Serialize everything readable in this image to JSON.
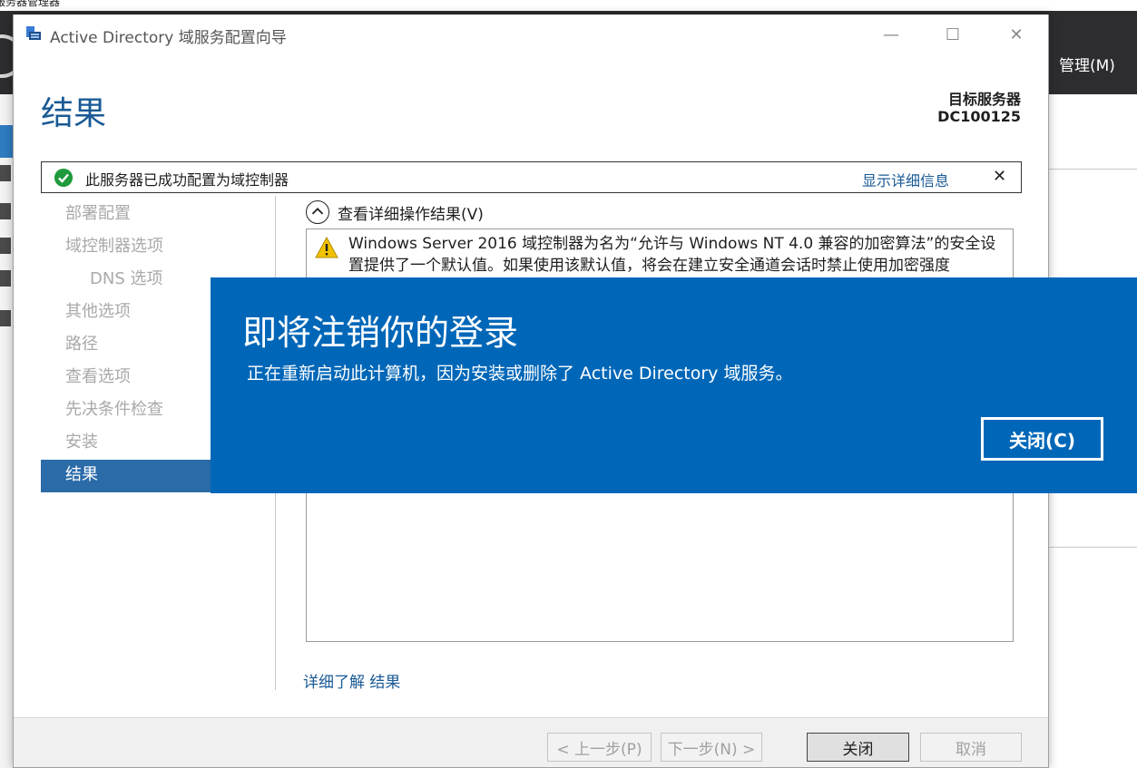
{
  "background": {
    "cut_title": "服务器管理器",
    "manage_menu": "管理(M)"
  },
  "window": {
    "title": "Active Directory 域服务配置向导",
    "minimize_glyph": "—",
    "maximize_glyph": "☐",
    "close_glyph": "✕"
  },
  "header": {
    "page_title": "结果",
    "target_label": "目标服务器",
    "target_name": "DC100125"
  },
  "notice": {
    "text": "此服务器已成功配置为域控制器",
    "details_link": "显示详细信息",
    "close_glyph": "✕"
  },
  "nav": {
    "items": [
      {
        "label": "部署配置",
        "sub": false,
        "active": false
      },
      {
        "label": "域控制器选项",
        "sub": false,
        "active": false
      },
      {
        "label": "DNS 选项",
        "sub": true,
        "active": false
      },
      {
        "label": "其他选项",
        "sub": false,
        "active": false
      },
      {
        "label": "路径",
        "sub": false,
        "active": false
      },
      {
        "label": "查看选项",
        "sub": false,
        "active": false
      },
      {
        "label": "先决条件检查",
        "sub": false,
        "active": false
      },
      {
        "label": "安装",
        "sub": false,
        "active": false
      },
      {
        "label": "结果",
        "sub": false,
        "active": true
      }
    ]
  },
  "results": {
    "expand_label": "查看详细操作结果(V)",
    "warning_text": "Windows Server 2016 域控制器为名为“允许与 Windows NT 4.0 兼容的加密算法”的安全设置提供了一个默认值。如果使用该默认值，将会在建立安全通道会话时禁止使用加密强度"
  },
  "learn_more_link": "详细了解 结果",
  "footer": {
    "prev_label": "< 上一步(P)",
    "next_label": "下一步(N) >",
    "finish_label": "关闭",
    "cancel_label": "取消"
  },
  "signout": {
    "title": "即将注销你的登录",
    "message": "正在重新启动此计算机，因为安装或删除了 Active Directory 域服务。",
    "close_label": "关闭(C)"
  },
  "colors": {
    "accent_blue": "#0067b8",
    "nav_selected": "#2a6ba8",
    "title_blue": "#1a5a95",
    "success_green": "#1f9a3c",
    "warning_yellow": "#f2c200"
  }
}
